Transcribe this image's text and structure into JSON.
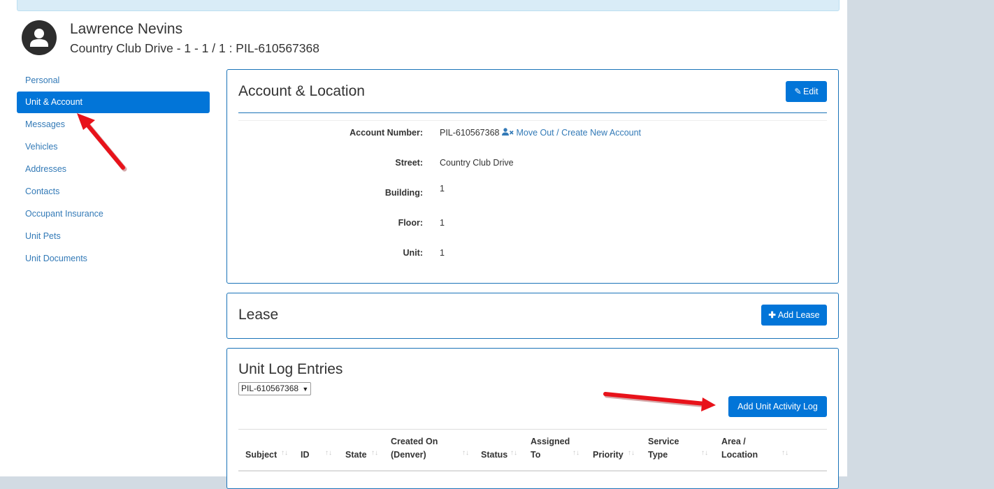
{
  "profile": {
    "name": "Lawrence Nevins",
    "subtitle": "Country Club Drive - 1 - 1 / 1 : PIL-610567368"
  },
  "sidenav": {
    "items": [
      {
        "label": "Personal"
      },
      {
        "label": "Unit & Account"
      },
      {
        "label": "Messages"
      },
      {
        "label": "Vehicles"
      },
      {
        "label": "Addresses"
      },
      {
        "label": "Contacts"
      },
      {
        "label": "Occupant Insurance"
      },
      {
        "label": "Unit Pets"
      },
      {
        "label": "Unit Documents"
      }
    ],
    "active_index": 1
  },
  "account_panel": {
    "title": "Account & Location",
    "edit_label": "Edit",
    "fields": {
      "account_number_label": "Account Number:",
      "account_number_value": "PIL-610567368",
      "move_out_link": "Move Out / Create New Account",
      "street_label": "Street:",
      "street_value": "Country Club Drive",
      "building_label": "Building:",
      "building_value": "1",
      "floor_label": "Floor:",
      "floor_value": "1",
      "unit_label": "Unit:",
      "unit_value": "1"
    }
  },
  "lease_panel": {
    "title": "Lease",
    "add_label": "Add Lease"
  },
  "unit_log_panel": {
    "title": "Unit Log Entries",
    "account_select": "PIL-610567368",
    "add_label": "Add Unit Activity Log",
    "columns": [
      {
        "line1": "",
        "line2": "Subject"
      },
      {
        "line1": "",
        "line2": "ID"
      },
      {
        "line1": "",
        "line2": "State"
      },
      {
        "line1": "Created On",
        "line2": "(Denver)"
      },
      {
        "line1": "",
        "line2": "Status"
      },
      {
        "line1": "Assigned",
        "line2": "To"
      },
      {
        "line1": "",
        "line2": "Priority"
      },
      {
        "line1": "Service",
        "line2": "Type"
      },
      {
        "line1": "Area /",
        "line2": "Location"
      }
    ]
  },
  "colors": {
    "primary": "#0275d8",
    "link": "#337ab7",
    "panel_border": "#1a73b8",
    "annotation_arrow": "#e8121a",
    "sidebar_bg": "#d2dbe3"
  },
  "icons": {
    "avatar": "user-circle-icon",
    "edit": "pencil-icon",
    "move_out": "user-times-icon",
    "add": "plus-icon",
    "sort": "sort-arrows-icon"
  }
}
